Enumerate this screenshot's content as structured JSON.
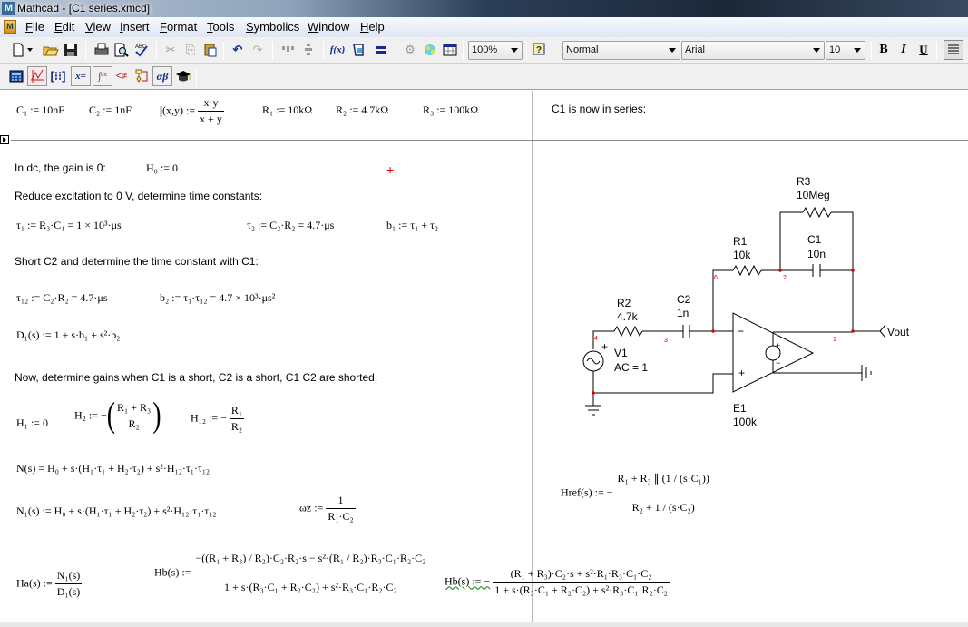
{
  "window": {
    "title": "Mathcad - [C1 series.xmcd]"
  },
  "menu": {
    "items": [
      "File",
      "Edit",
      "View",
      "Insert",
      "Format",
      "Tools",
      "Symbolics",
      "Window",
      "Help"
    ]
  },
  "toolbar": {
    "zoom": "100%",
    "style": "Normal",
    "font": "Arial",
    "size": "10",
    "bold": "B",
    "italic": "I",
    "underline": "U",
    "icons": [
      "new-icon",
      "open-icon",
      "save-icon",
      "print-icon",
      "print-preview-icon",
      "spell-check-icon",
      "cut-icon",
      "copy-icon",
      "paste-icon",
      "undo-icon",
      "redo-icon",
      "align-across-icon",
      "align-down-icon",
      "insert-function-icon",
      "insert-unit-icon",
      "calculate-icon",
      "insert-component-icon",
      "resource-center-icon",
      "table-icon",
      "help-icon"
    ],
    "math_icons": [
      "calculator-icon",
      "graph-icon",
      "matrix-icon",
      "evaluation-icon",
      "calculus-icon",
      "boolean-icon",
      "programming-icon",
      "greek-icon",
      "symbolic-icon"
    ]
  },
  "header_region": {
    "c1": "C₁ := 10nF",
    "c2": "C₂ := 1nF",
    "par_lhs": "(x,y) :=",
    "par_num": "x·y",
    "par_den": "x + y",
    "r1": "R₁ := 10kΩ",
    "r2": "R₂ := 4.7kΩ",
    "r3": "R₃ := 100kΩ",
    "right_note": "C1 is now in series:"
  },
  "worksheet": {
    "dc_text": "In dc, the gain is 0:",
    "h0": "H₀ := 0",
    "reduce_text": "Reduce excitation to 0 V, determine time constants:",
    "tau1": "τ₁ := R₃·C₁ = 1 × 10³·μs",
    "tau2": "τ₂ := C₂·R₂ = 4.7·μs",
    "b1": "b₁ := τ₁ + τ₂",
    "short_text": "Short C2 and determine the time constant with C1:",
    "tau12": "τ₁₂ := C₂·R₂ = 4.7·μs",
    "b2": "b₂ := τ₁·τ₁₂ = 4.7 × 10³·μs²",
    "d1": "D₁(s) := 1 + s·b₁ + s²·b₂",
    "gains_text": "Now, determine gains when C1 is a short, C2 is a short, C1 C2 are shorted:",
    "h1": "H₁ := 0",
    "h2_lhs": "H₂ := −",
    "h2_num": "R₁ + R₃",
    "h2_den": "R₂",
    "h12_lhs": "H₁₂ := −",
    "h12_num": "R₁",
    "h12_den": "R₂",
    "ns": "N(s) = H₀ + s·(H₁·τ₁ + H₂·τ₂) + s²·H₁₂·τ₁·τ₁₂",
    "n1s": "N₁(s) := H₀ + s·(H₁·τ₁ + H₂·τ₂) + s²·H₁₂·τ₁·τ₁₂",
    "wz_lhs": "ωz :=",
    "wz_num": "1",
    "wz_den": "R₁·C₂",
    "href_lhs": "Href(s) := −",
    "href_num": "R₁ + R₃ ∥ (1 / (s·C₁))",
    "href_den": "R₂ + 1 / (s·C₂)",
    "ha_lhs": "Ha(s) :=",
    "ha_num": "N₁(s)",
    "ha_den": "D₁(s)",
    "hb_lhs": "Hb(s) :=",
    "hb_num": "−((R₁ + R₃) / R₂)·C₂·R₂·s − s²·(R₁ / R₂)·R₃·C₁·R₂·C₂",
    "hb_den": "1 + s·(R₃·C₁ + R₂·C₂) + s²·R₃·C₁·R₂·C₂",
    "hb2_lhs": "Hb(s) := −",
    "hb2_num": "(R₁ + R₃)·C₂·s + s²·R₁·R₃·C₁·C₂",
    "hb2_den": "1 + s·(R₃·C₁ + R₂·C₂) + s²·R₃·C₁·R₂·C₂"
  },
  "schematic": {
    "r3": {
      "name": "R3",
      "value": "10Meg"
    },
    "r1": {
      "name": "R1",
      "value": "10k"
    },
    "c1": {
      "name": "C1",
      "value": "10n"
    },
    "r2": {
      "name": "R2",
      "value": "4.7k"
    },
    "c2": {
      "name": "C2",
      "value": "1n"
    },
    "v1": {
      "name": "V1",
      "value": "AC = 1"
    },
    "e1": {
      "name": "E1",
      "value": "100k"
    },
    "vout": "Vout",
    "nodes": [
      "6",
      "2",
      "4",
      "3",
      "1"
    ],
    "node_color": "#ff0000"
  }
}
